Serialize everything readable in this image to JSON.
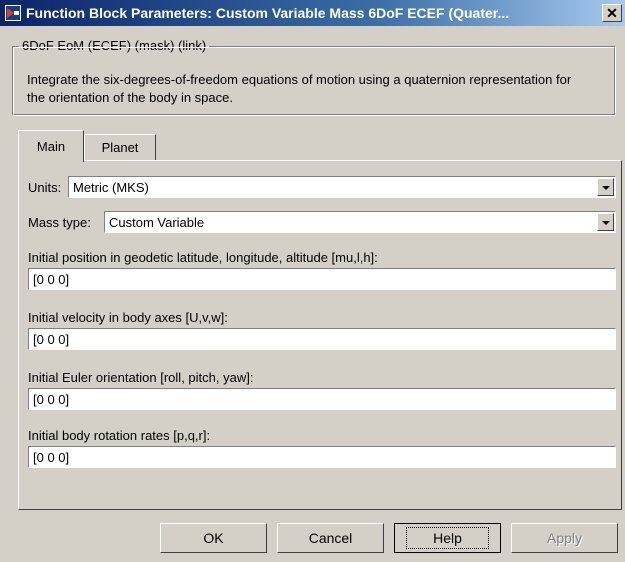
{
  "window": {
    "title": "Function Block Parameters: Custom Variable Mass 6DoF ECEF (Quater...",
    "close_glyph": "✕"
  },
  "group": {
    "label": "6DoF EoM (ECEF) (mask) (link)",
    "description": "Integrate the six-degrees-of-freedom equations of motion using a quaternion representation for the orientation of the body in space."
  },
  "tabs": [
    {
      "label": "Main",
      "active": true
    },
    {
      "label": "Planet",
      "active": false
    }
  ],
  "params": {
    "units": {
      "label": "Units:",
      "value": "Metric (MKS)"
    },
    "mass_type": {
      "label": "Mass type:",
      "value": "Custom Variable"
    },
    "initial_position": {
      "label": "Initial position in geodetic latitude, longitude, altitude [mu,l,h]:",
      "value": "[0 0 0]"
    },
    "initial_velocity": {
      "label": "Initial velocity in body axes [U,v,w]:",
      "value": "[0 0 0]"
    },
    "initial_euler": {
      "label": "Initial Euler orientation [roll, pitch, yaw]:",
      "value": "[0 0 0]"
    },
    "initial_rates": {
      "label": "Initial body rotation rates [p,q,r]:",
      "value": "[0 0 0]"
    }
  },
  "buttons": {
    "ok": "OK",
    "cancel": "Cancel",
    "help": "Help",
    "apply": "Apply"
  }
}
